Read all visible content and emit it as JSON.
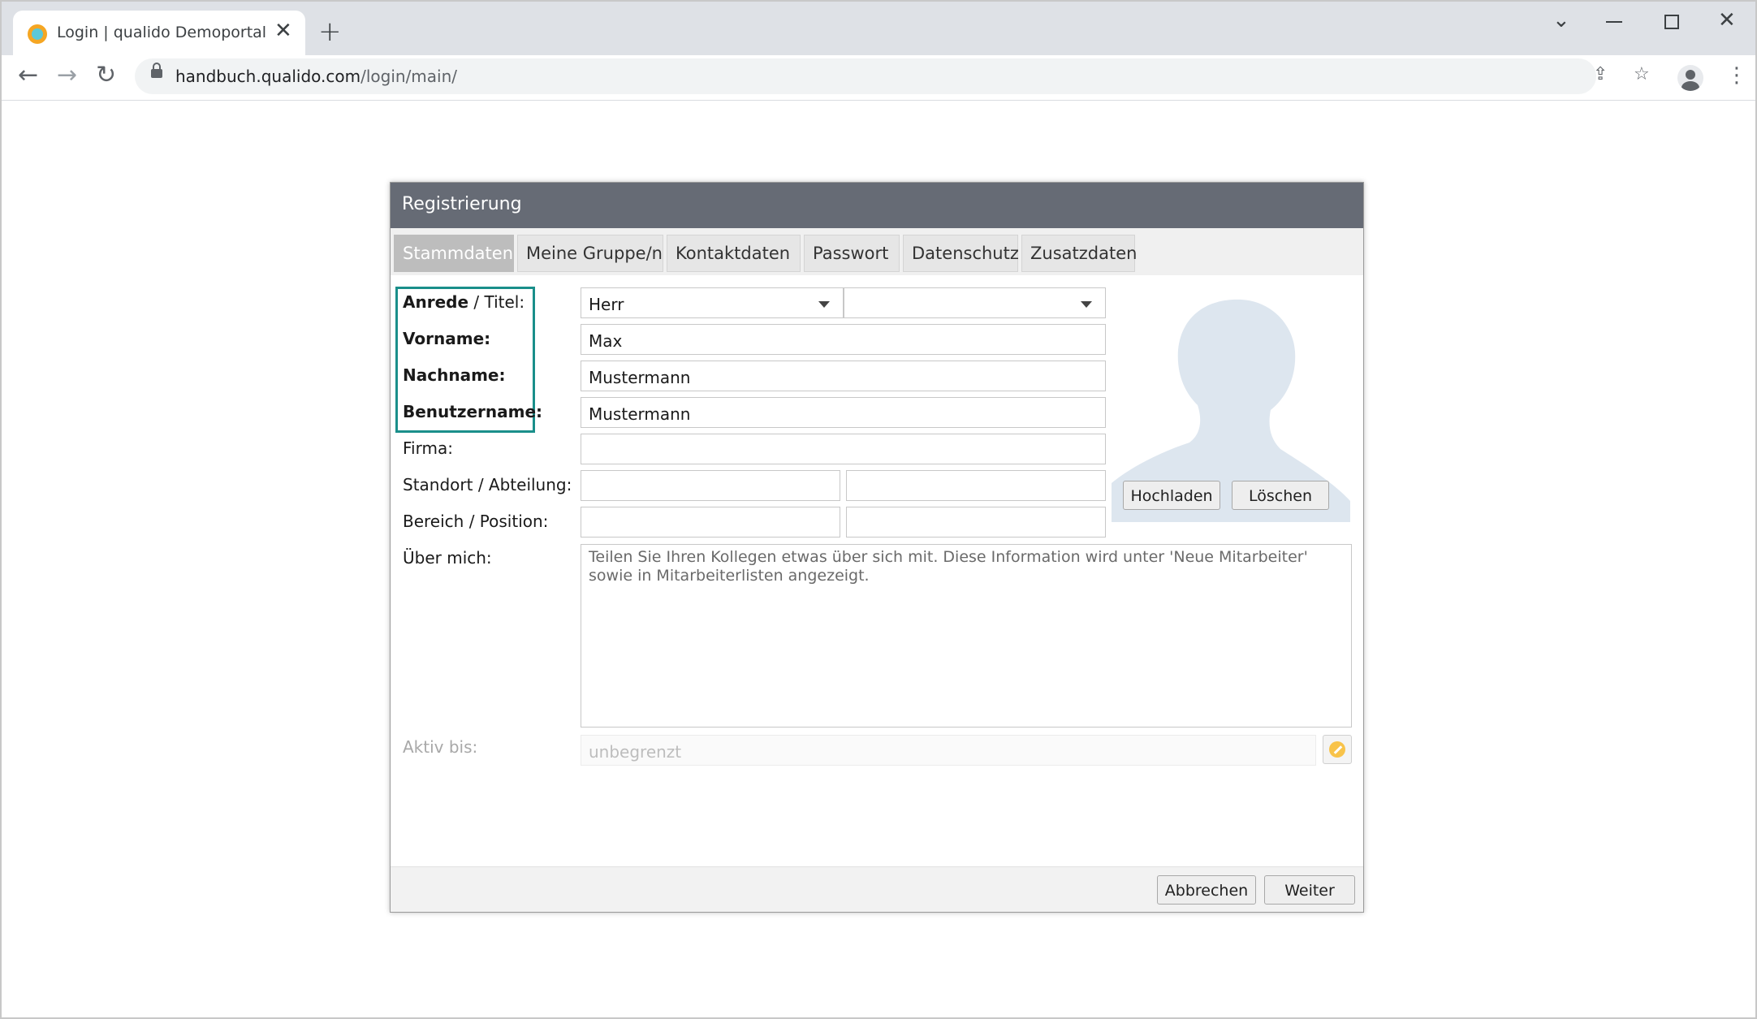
{
  "browser": {
    "tab_title": "Login | qualido Demoportal",
    "url_host": "handbuch.qualido.com",
    "url_path": "/login/main/"
  },
  "dialog": {
    "title": "Registrierung",
    "tabs": [
      {
        "label": "Stammdaten",
        "active": true
      },
      {
        "label": "Meine Gruppe/n",
        "active": false
      },
      {
        "label": "Kontaktdaten",
        "active": false
      },
      {
        "label": "Passwort",
        "active": false
      },
      {
        "label": "Datenschutz",
        "active": false
      },
      {
        "label": "Zusatzdaten",
        "active": false
      }
    ],
    "form": {
      "anrede_label": "Anrede",
      "titel_label": " / Titel:",
      "vorname_label": "Vorname:",
      "nachname_label": "Nachname:",
      "benutzername_label": "Benutzername:",
      "firma_label": "Firma:",
      "standort_label": "Standort / Abteilung:",
      "bereich_label": "Bereich / Position:",
      "ueber_label": "Über mich:",
      "aktiv_label": "Aktiv bis:",
      "anrede_value": "Herr",
      "titel_value": "",
      "vorname_value": "Max",
      "nachname_value": "Mustermann",
      "benutzername_value": "Mustermann",
      "firma_value": "",
      "standort_value": "",
      "abteilung_value": "",
      "bereich_value": "",
      "position_value": "",
      "ueber_placeholder": "Teilen Sie Ihren Kollegen etwas über sich mit. Diese Information wird unter 'Neue Mitarbeiter' sowie in Mitarbeiterlisten angezeigt.",
      "aktiv_value": "unbegrenzt"
    },
    "photo": {
      "upload_label": "Hochladen",
      "delete_label": "Löschen"
    },
    "footer": {
      "cancel_label": "Abbrechen",
      "next_label": "Weiter"
    }
  },
  "colors": {
    "header_bg": "#666b75",
    "highlight_border": "#1a8f8a",
    "silhouette": "#dde6ef",
    "calendar_icon": "#f8c34a"
  },
  "icons": {
    "favicon": "qualido-logo-icon",
    "calendar": "calendar-icon",
    "silhouette": "person-silhouette-icon"
  }
}
